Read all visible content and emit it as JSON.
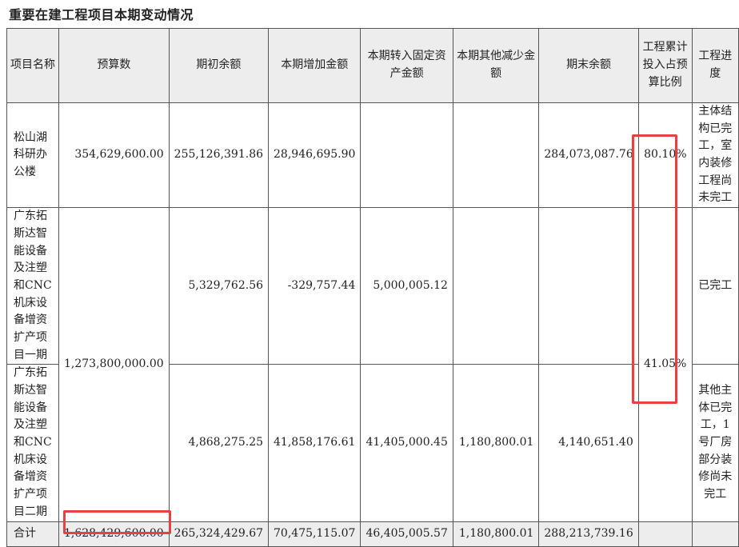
{
  "title": "重要在建工程项目本期变动情况",
  "headers": [
    "项目名称",
    "预算数",
    "期初余额",
    "本期增加金额",
    "本期转入固定资产金额",
    "本期其他减少金额",
    "期末余额",
    "工程累计投入占预算比例",
    "工程进度"
  ],
  "rows": [
    {
      "name": "松山湖科研办公楼",
      "budget": "354,629,600.00",
      "opening": "255,126,391.86",
      "increase": "28,946,695.90",
      "transfer": "",
      "other_decrease": "",
      "closing": "284,073,087.76",
      "ratio": "80.10%",
      "progress": "主体结构已完工，室内装修工程尚未完工"
    },
    {
      "name": "广东拓斯达智能设备及注塑和CNC机床设备增资扩产项目一期",
      "budget": "1,273,800,000.00",
      "opening": "5,329,762.56",
      "increase": "-329,757.44",
      "transfer": "5,000,005.12",
      "other_decrease": "",
      "closing": "",
      "ratio": "41.05%",
      "progress": "已完工"
    },
    {
      "name": "广东拓斯达智能设备及注塑和CNC机床设备增资扩产项目二期",
      "opening": "4,868,275.25",
      "increase": "41,858,176.61",
      "transfer": "41,405,000.45",
      "other_decrease": "1,180,800.01",
      "closing": "4,140,651.40",
      "progress": "其他主体已完工，1号厂房部分装修尚未完工"
    }
  ],
  "total": {
    "label": "合计",
    "budget": "1,628,429,600.00",
    "opening": "265,324,429.67",
    "increase": "70,475,115.07",
    "transfer": "46,405,005.57",
    "other_decrease": "1,180,800.01",
    "closing": "288,213,739.16",
    "ratio": "",
    "progress": ""
  },
  "colors": {
    "highlight": "#e94040",
    "header_bg": "#ededed",
    "border": "#555555"
  }
}
